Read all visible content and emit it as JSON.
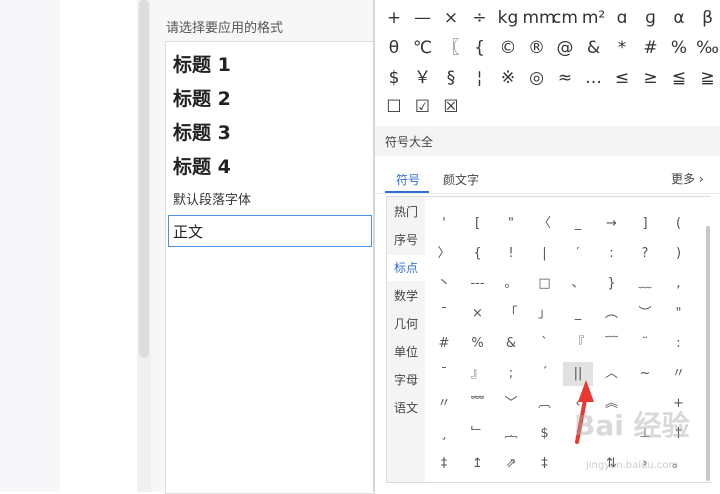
{
  "style_panel": {
    "title": "请选择要应用的格式",
    "styles": [
      "标题 1",
      "标题 2",
      "标题 3",
      "标题 4",
      "默认段落字体",
      "正文"
    ]
  },
  "recent_symbols": [
    [
      "+",
      "—",
      "×",
      "÷",
      "kg",
      "mm",
      "cm",
      "m²",
      "ɑ",
      "ɡ",
      "α",
      "β"
    ],
    [
      "θ",
      "℃",
      "〖",
      "{",
      "©",
      "®",
      "@",
      "&",
      "*",
      "#",
      "%",
      "‰"
    ],
    [
      "$",
      "￥",
      "§",
      "¦",
      "※",
      "◎",
      "≈",
      "…",
      "≤",
      "≥",
      "≦",
      "≧"
    ],
    [
      "☐",
      "☑",
      "☒"
    ]
  ],
  "section_title": "符号大全",
  "tabs": {
    "symbols": "符号",
    "kaomoji": "颜文字",
    "more": "更多"
  },
  "categories": [
    "热门",
    "序号",
    "标点",
    "数学",
    "几何",
    "单位",
    "字母",
    "语文"
  ],
  "active_category": "标点",
  "symbol_grid": [
    [
      "'",
      "[",
      "\"",
      "〈",
      "_",
      "→",
      "]",
      "("
    ],
    [
      "〉",
      "{",
      "!",
      "|",
      "′",
      ":",
      "?",
      ")"
    ],
    [
      "丶",
      "---",
      "。",
      "□",
      "、",
      "}",
      "﹏",
      ","
    ],
    [
      "¯",
      "×",
      "「",
      "」",
      "_",
      "︵",
      "︶",
      "\""
    ],
    [
      "#",
      "%",
      "&",
      "`",
      "『",
      "﹋",
      "¨",
      ":"
    ],
    [
      "¯",
      "』",
      ";",
      "´",
      "||",
      "︿",
      "~",
      "〃"
    ],
    [
      "〃",
      "﹌",
      "﹀",
      "︹",
      "‹",
      "︽",
      "",
      "+"
    ],
    [
      "¸",
      "﹂",
      "︷",
      "$",
      "›",
      "",
      "⊥",
      "†"
    ],
    [
      "‡",
      "↥",
      "⇗",
      "‡",
      "",
      "⇅",
      "›",
      "。"
    ]
  ],
  "highlighted_symbol": "||",
  "watermark": {
    "text": "Bai 经验",
    "sub": "jingyan.baidu.com"
  },
  "colors": {
    "accent": "#2f6fd6",
    "arrow": "#e8382f"
  }
}
